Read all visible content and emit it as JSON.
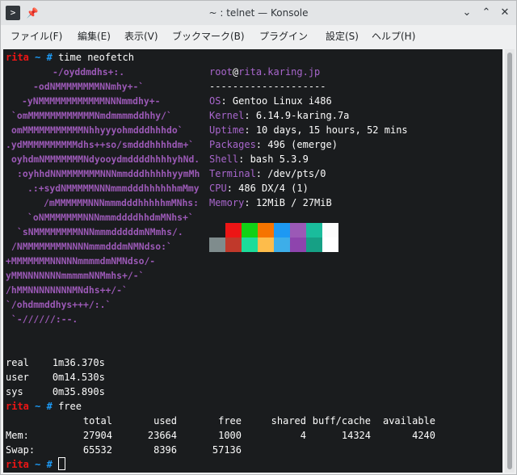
{
  "window": {
    "title": "~ : telnet — Konsole",
    "app_icon": ">",
    "pin_icon": "📌",
    "buttons": {
      "minimize": "⌄",
      "maximize": "⌃",
      "close": "✕"
    }
  },
  "menu": [
    "ファイル(F)",
    "編集(E)",
    "表示(V)",
    "ブックマーク(B)",
    "プラグイン",
    "設定(S)",
    "ヘルプ(H)"
  ],
  "prompt": {
    "user": "rita",
    "path": "~",
    "symbol": "#"
  },
  "commands": {
    "first": "time neofetch",
    "second": "free"
  },
  "neofetch": {
    "logo": [
      "-/oyddmdhs+:.",
      "-odNMMMMMMMMNNmhy+-`",
      "-yNMMMMMMMMMMMMNNNmmdhy+-",
      "`omMMMMMMMMMMMMNmdmmmmddhhy/`",
      "omMMMMMMMMMMMNhhyyyohmdddhhhdo`",
      ".ydMMMMMMMMMMdhs++so/smdddhhhhdm+`",
      "oyhdmNMMMMMMMNdyooydmddddhhhhyhNd.",
      ":oyhhdNNMMMMMMMNNNmmdddhhhhhyymMh",
      ".:+sydNMMMMMNNNmmmdddhhhhhhmMmy",
      "/mMMMMMMNNNmmmdddhhhhhmMNhs:",
      "`oNMMMMMMMNNNmmmddddhhdmMNhs+`",
      "`sNMMMMMMMMNNNmmmdddddmNMmhs/.",
      "/NMMMMMMMMNNNNmmmdddmNMNdso:`",
      "+MMMMMMMNNNNNmmmmdmNMNdso/-",
      "yMMNNNNNNNmmmmmNNMmhs+/-`",
      "/hMMNNNNNNNNMNdhs++/-`",
      "`/ohdmmddhys+++/:.`",
      "`-//////:--."
    ],
    "user": "root",
    "at": "@",
    "host": "rita.karing.jp",
    "separator": "--------------------",
    "info": [
      {
        "key": "OS",
        "value": "Gentoo Linux i486"
      },
      {
        "key": "Kernel",
        "value": "6.14.9-karing.7a"
      },
      {
        "key": "Uptime",
        "value": "10 days, 15 hours, 52 mins"
      },
      {
        "key": "Packages",
        "value": "496 (emerge)"
      },
      {
        "key": "Shell",
        "value": "bash 5.3.9"
      },
      {
        "key": "Terminal",
        "value": "/dev/pts/0"
      },
      {
        "key": "CPU",
        "value": "486 DX/4 (1)"
      },
      {
        "key": "Memory",
        "value": "12MiB / 27MiB"
      }
    ],
    "colors_row1": [
      "#1a1c1e",
      "#ed1515",
      "#11d116",
      "#f67400",
      "#1d99f3",
      "#9b59b6",
      "#1abc9c",
      "#fcfcfc"
    ],
    "colors_row2": [
      "#7f8c8d",
      "#c0392b",
      "#1cdc9a",
      "#fdbc4b",
      "#3daee9",
      "#8e44ad",
      "#16a085",
      "#ffffff"
    ]
  },
  "timing": [
    {
      "label": "real",
      "value": "1m36.370s"
    },
    {
      "label": "user",
      "value": "0m14.530s"
    },
    {
      "label": "sys",
      "value": "0m35.890s"
    }
  ],
  "free": {
    "headers": [
      "total",
      "used",
      "free",
      "shared",
      "buff/cache",
      "available"
    ],
    "rows": [
      {
        "label": "Mem:",
        "values": [
          "27904",
          "23664",
          "1000",
          "4",
          "14324",
          "4240"
        ]
      },
      {
        "label": "Swap:",
        "values": [
          "65532",
          "8396",
          "57136",
          "",
          "",
          ""
        ]
      }
    ]
  }
}
